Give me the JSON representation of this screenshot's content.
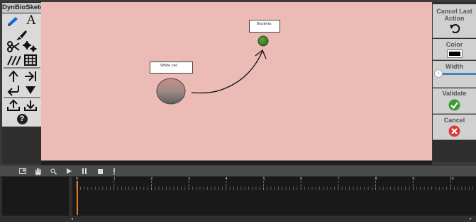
{
  "app": {
    "title": "DynBioSketch"
  },
  "left_toolbar": {
    "tools": [
      {
        "icon": "pencil-icon"
      },
      {
        "icon": "text-icon",
        "glyph": "A"
      },
      {
        "icon": "brush-icon"
      },
      {
        "icon": "scissors-icon"
      },
      {
        "icon": "gears-icon"
      },
      {
        "icon": "hatch-icon"
      },
      {
        "icon": "grid-icon"
      },
      {
        "icon": "arrow-up-icon"
      },
      {
        "icon": "arrow-right-bar-icon"
      },
      {
        "icon": "arrow-return-left-icon"
      },
      {
        "icon": "triangle-down-icon"
      },
      {
        "icon": "upload-icon"
      },
      {
        "icon": "download-icon"
      },
      {
        "icon": "help-icon",
        "glyph": "?"
      }
    ]
  },
  "canvas": {
    "background": "#ecbbb5",
    "white_cell_label": "White cell",
    "bacteria_label": "Bacteria"
  },
  "right_panel": {
    "cancel_last_action": "Cancel Last Action",
    "color_label": "Color",
    "color_value": "#000000",
    "width_label": "Width",
    "width_value": "1",
    "validate_label": "Validate",
    "cancel_label": "Cancel"
  },
  "timeline": {
    "ruler_labels": [
      "0",
      "1",
      "2",
      "3",
      "4",
      "5",
      "6",
      "7",
      "8",
      "9",
      "10"
    ],
    "toolbar_icons": [
      "image-icon",
      "hand-icon",
      "zoom-icon",
      "play-icon",
      "pause-icon",
      "stop-icon",
      "marker-icon"
    ]
  }
}
